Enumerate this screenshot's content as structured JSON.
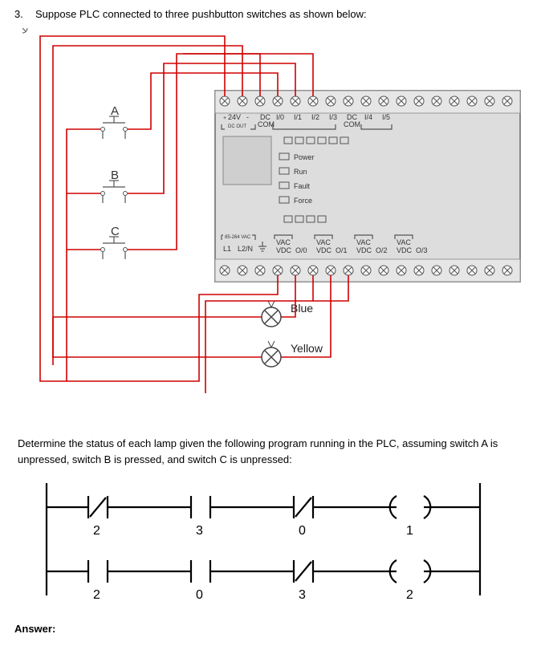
{
  "question": {
    "number": "3.",
    "prompt": "Suppose PLC connected to three pushbutton switches as shown below:"
  },
  "switches": {
    "A": "A",
    "B": "B",
    "C": "C"
  },
  "plc": {
    "top_labels": {
      "v24": "24V",
      "dcout": "DC OUT",
      "dccom1": "DC",
      "com1": "COM",
      "i0": "I/0",
      "i1": "I/1",
      "i2": "I/2",
      "i3": "I/3",
      "dccom2": "DC",
      "com2": "COM",
      "i4": "I/4",
      "i5": "I/5"
    },
    "status": {
      "power": "Power",
      "run": "Run",
      "fault": "Fault",
      "force": "Force"
    },
    "bottom": {
      "vac_range": "85-264 VAC",
      "L1": "L1",
      "L2N": "L2/N",
      "VAC": "VAC",
      "VDC": "VDC",
      "O0": "O/0",
      "O1": "O/1",
      "O2": "O/2",
      "O3": "O/3"
    }
  },
  "lamps": {
    "blue": "Blue",
    "yellow": "Yellow"
  },
  "midtext": "Determine the status of each lamp given the following program running in the PLC, assuming switch A is unpressed, switch B is pressed, and switch C is unpressed:",
  "ladder": {
    "rung1": {
      "c1": "2",
      "c2": "3",
      "c3": "0",
      "out": "1"
    },
    "rung2": {
      "c1": "2",
      "c2": "0",
      "c3": "3",
      "out": "2"
    }
  },
  "answer_label": "Answer:"
}
